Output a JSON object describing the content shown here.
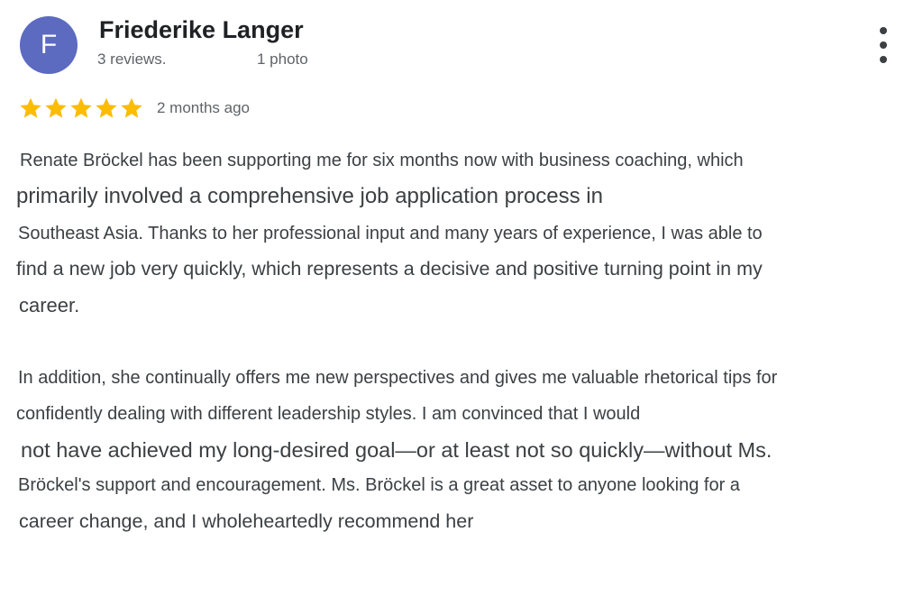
{
  "reviewer": {
    "initial": "F",
    "name": "Friederike Langer",
    "reviews_text": "3 reviews.",
    "photos_text": "1 photo",
    "avatar_color": "#5c6bc0"
  },
  "menu": {
    "icon": "more-vertical-icon"
  },
  "rating": {
    "stars": 5,
    "max": 5,
    "star_color": "#fbbc04",
    "date": "2 months ago"
  },
  "review": {
    "lines": [
      "Renate Bröckel has been supporting me for six months now with business coaching, which",
      "primarily involved a comprehensive job application process in",
      "Southeast Asia. Thanks to her professional input and many years of experience, I was able to",
      "find a new job very quickly, which represents a decisive and positive turning point in my",
      "career.",
      "In addition, she continually offers me new perspectives and gives me valuable rhetorical tips for",
      "confidently dealing with different leadership styles. I am convinced that I would",
      "not have achieved my long-desired goal—or at least not so quickly—without Ms.",
      "Bröckel's support and encouragement. Ms. Bröckel is a great asset to anyone looking for a",
      "career change, and I wholeheartedly recommend her"
    ]
  }
}
